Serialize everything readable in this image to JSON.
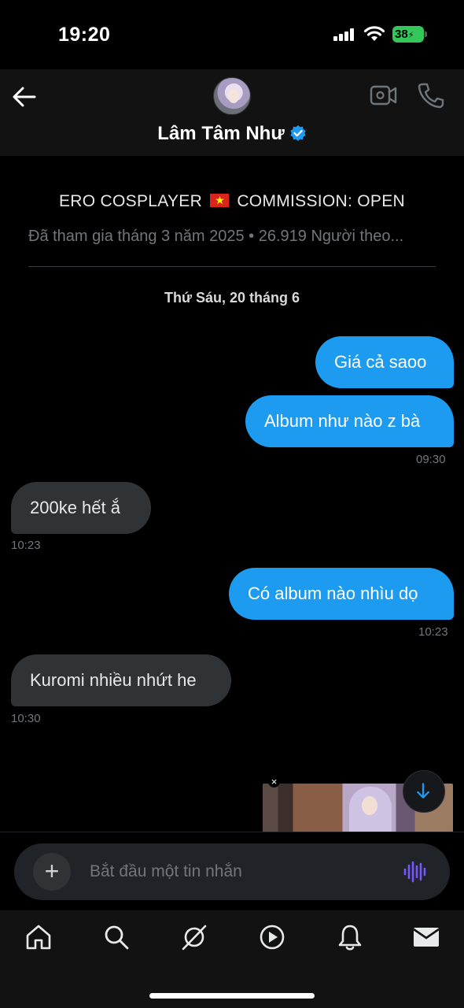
{
  "status_bar": {
    "time": "19:20",
    "battery": "38"
  },
  "header": {
    "name": "Lâm Tâm Như",
    "avatar": "avatar"
  },
  "profile": {
    "bio_before_flag": "ERO COSPLAYER",
    "bio_after_flag": "COMMISSION: OPEN",
    "meta": "Đã tham gia tháng 3 năm 2025 • 26.919 Người theo..."
  },
  "date_separator": "Thứ Sáu, 20 tháng 6",
  "messages": [
    {
      "direction": "sent",
      "text": "Giá cả saoo",
      "time": ""
    },
    {
      "direction": "sent",
      "text": "Album như nào z bà",
      "time": "09:30"
    },
    {
      "direction": "received",
      "text": "200ke hết ắ",
      "time": "10:23"
    },
    {
      "direction": "sent",
      "text": "Có album nào nhìu dọ",
      "time": "10:23"
    },
    {
      "direction": "received",
      "text": "Kuromi nhiều nhứt he",
      "time": "10:30"
    }
  ],
  "preview_close": "×",
  "composer": {
    "placeholder": "Bắt đầu một tin nhắn",
    "value": "",
    "plus": "+"
  },
  "nav": {
    "items": [
      "home-icon",
      "search-icon",
      "grok-icon",
      "video-icon",
      "notifications-icon",
      "messages-icon"
    ],
    "active": "messages-icon"
  },
  "colors": {
    "accent": "#1d9bf0",
    "received_bubble": "#2f3336",
    "voice": "#7856ff",
    "battery": "#34c759"
  }
}
